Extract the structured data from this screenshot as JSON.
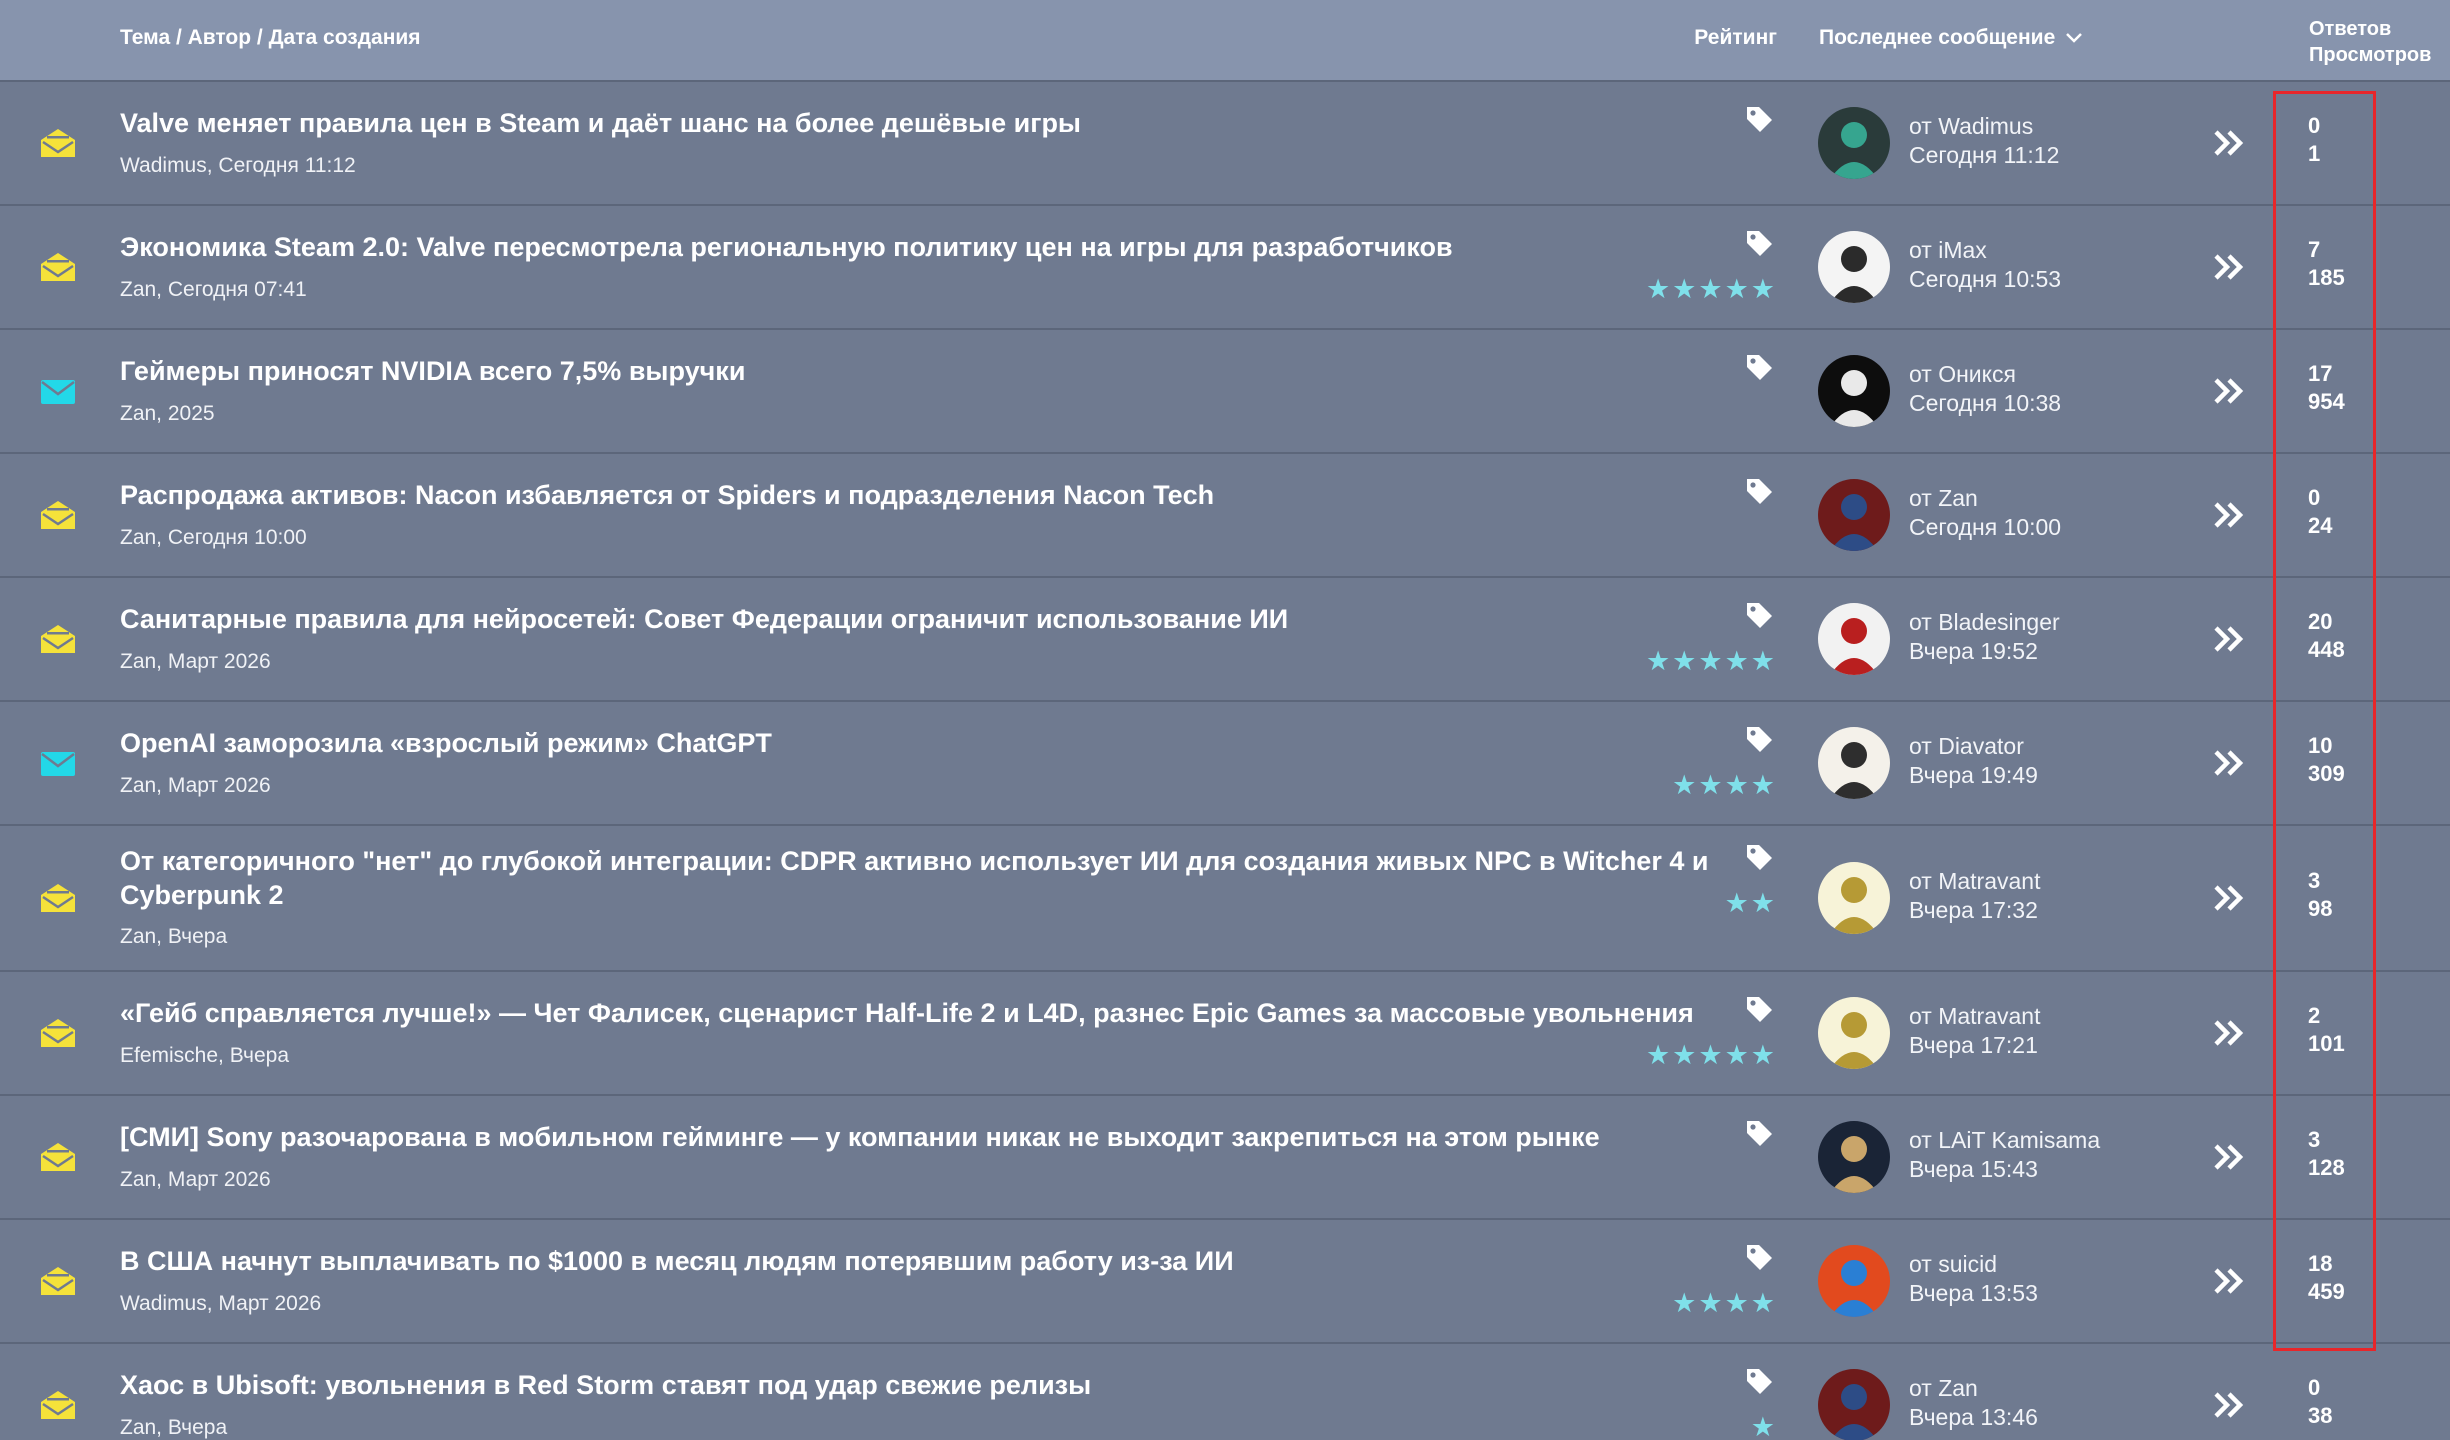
{
  "header": {
    "topic": "Тема / Автор / Дата создания",
    "rating": "Рейтинг",
    "last_message": "Последнее сообщение",
    "replies": "Ответов",
    "views": "Просмотров"
  },
  "colors": {
    "background": "#6f7a90",
    "header_bg": "#8794ad",
    "envelope_read": "#f5e23a",
    "envelope_new": "#23d8e8",
    "stars": "#7fe0ea",
    "highlight_box": "#e8262a"
  },
  "icons": {
    "envelope_read": "envelope-open-icon",
    "envelope_new": "envelope-icon",
    "tag": "tag-icon",
    "go": "double-chevron-right-icon",
    "sort": "chevron-down-icon"
  },
  "threads": [
    {
      "title": "Valve меняет правила цен в Steam и даёт шанс на более дешёвые игры",
      "meta": "Wadimus, Сегодня 11:12",
      "stars": "",
      "rating": 0,
      "unread": false,
      "last_by": "от Wadimus",
      "last_time": "Сегодня 11:12",
      "replies": "0",
      "views": "1"
    },
    {
      "title": "Экономика Steam 2.0: Valve пересмотрела региональную политику цен на игры для разработчиков",
      "meta": "Zan, Сегодня 07:41",
      "stars": "★★★★★",
      "rating": 5,
      "unread": false,
      "last_by": "от iMax",
      "last_time": "Сегодня 10:53",
      "replies": "7",
      "views": "185"
    },
    {
      "title": "Геймеры приносят NVIDIA всего 7,5% выручки",
      "meta": "Zan, 2025",
      "stars": "",
      "rating": 0,
      "unread": true,
      "last_by": "от Оникся",
      "last_time": "Сегодня 10:38",
      "replies": "17",
      "views": "954"
    },
    {
      "title": "Распродажа активов: Nacon избавляется от Spiders и подразделения Nacon Tech",
      "meta": "Zan, Сегодня 10:00",
      "stars": "",
      "rating": 0,
      "unread": false,
      "last_by": "от Zan",
      "last_time": "Сегодня 10:00",
      "replies": "0",
      "views": "24"
    },
    {
      "title": "Санитарные правила для нейросетей: Совет Федерации ограничит использование ИИ",
      "meta": "Zan, Март 2026",
      "stars": "★★★★★",
      "rating": 5,
      "unread": false,
      "last_by": "от Bladesinger",
      "last_time": "Вчера 19:52",
      "replies": "20",
      "views": "448"
    },
    {
      "title": "OpenAI заморозила «взрослый режим» ChatGPT",
      "meta": "Zan, Март 2026",
      "stars": "★★★★",
      "rating": 4,
      "unread": true,
      "last_by": "от Diavator",
      "last_time": "Вчера 19:49",
      "replies": "10",
      "views": "309"
    },
    {
      "title": "От категоричного \"нет\" до глубокой интеграции: CDPR активно использует ИИ для создания живых NPC в Witcher 4 и Cyberpunk 2",
      "meta": "Zan, Вчера",
      "stars": "★★",
      "rating": 2,
      "unread": false,
      "last_by": "от Matravant",
      "last_time": "Вчера 17:32",
      "replies": "3",
      "views": "98"
    },
    {
      "title": "«Гейб справляется лучше!» — Чет Фалисек, сценарист Half-Life 2 и L4D, разнес Epic Games за массовые увольнения",
      "meta": "Efemische, Вчера",
      "stars": "★★★★★",
      "rating": 5,
      "unread": false,
      "last_by": "от Matravant",
      "last_time": "Вчера 17:21",
      "replies": "2",
      "views": "101"
    },
    {
      "title": "[СМИ] Sony разочарована в мобильном гейминге — у компании никак не выходит закрепиться на этом рынке",
      "meta": "Zan, Март 2026",
      "stars": "",
      "rating": 0,
      "unread": false,
      "last_by": "от LAiT Kamisama",
      "last_time": "Вчера 15:43",
      "replies": "3",
      "views": "128"
    },
    {
      "title": "В США начнут выплачивать по $1000 в месяц людям потерявшим работу из-за ИИ",
      "meta": "Wadimus, Март 2026",
      "stars": "★★★★",
      "rating": 4,
      "unread": false,
      "last_by": "от suicid",
      "last_time": "Вчера 13:53",
      "replies": "18",
      "views": "459"
    },
    {
      "title": "Хаос в Ubisoft: увольнения в Red Storm ставят под удар свежие релизы",
      "meta": "Zan, Вчера",
      "stars": "★",
      "rating": 1,
      "unread": false,
      "last_by": "от Zan",
      "last_time": "Вчера 13:46",
      "replies": "0",
      "views": "38"
    }
  ]
}
